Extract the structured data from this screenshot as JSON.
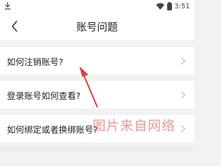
{
  "status_bar": {
    "time": "3:51",
    "left_icon": "download-icon",
    "wifi_icon": "wifi-icon",
    "battery_icon": "battery-icon"
  },
  "header": {
    "title": "账号问题",
    "back_icon": "back-chevron-icon"
  },
  "list": {
    "items": [
      {
        "label": "如何注销账号?"
      },
      {
        "label": "登录账号如何查看?"
      },
      {
        "label": "如何绑定或者换绑账号?"
      }
    ]
  },
  "watermark": "图片来自网络",
  "colors": {
    "annotation_arrow": "#e23b3b",
    "watermark": "#dc4646"
  }
}
